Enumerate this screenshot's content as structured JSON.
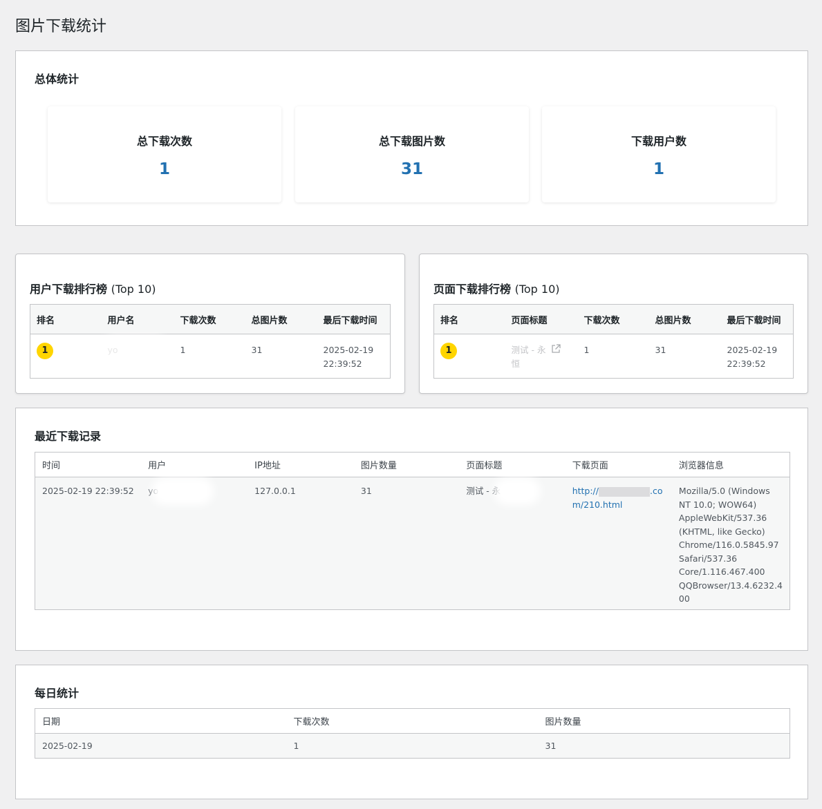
{
  "page_title": "图片下载统计",
  "overall": {
    "title": "总体统计",
    "stats": [
      {
        "label": "总下载次数",
        "value": "1"
      },
      {
        "label": "总下载图片数",
        "value": "31"
      },
      {
        "label": "下载用户数",
        "value": "1"
      }
    ]
  },
  "user_rank": {
    "title": "用户下载排行榜",
    "suffix": "(Top 10)",
    "columns": [
      "排名",
      "用户名",
      "下载次数",
      "总图片数",
      "最后下载时间"
    ],
    "rows": [
      {
        "rank": "1",
        "user": "yo",
        "downloads": "1",
        "images": "31",
        "last_date": "2025-02-19",
        "last_time": "22:39:52"
      }
    ]
  },
  "page_rank": {
    "title": "页面下载排行榜",
    "suffix": "(Top 10)",
    "columns": [
      "排名",
      "页面标题",
      "下载次数",
      "总图片数",
      "最后下载时间"
    ],
    "rows": [
      {
        "rank": "1",
        "title_line1": "测试 - 永",
        "title_line2": "恒",
        "downloads": "1",
        "images": "31",
        "last_date": "2025-02-19",
        "last_time": "22:39:52"
      }
    ]
  },
  "recent": {
    "title": "最近下载记录",
    "columns": [
      "时间",
      "用户",
      "IP地址",
      "图片数量",
      "页面标题",
      "下载页面",
      "浏览器信息"
    ],
    "rows": [
      {
        "time": "2025-02-19 22:39:52",
        "user": "yo",
        "ip": "127.0.0.1",
        "images": "31",
        "page_title": "测试 - 永",
        "url_start": "http://",
        "url_end": ".co",
        "url_line2": "m/210.html",
        "browser": [
          "Mozilla/5.0 (Windows",
          "NT 10.0; WOW64)",
          "AppleWebKit/537.36",
          "(KHTML, like Gecko)",
          "Chrome/116.0.5845.97",
          "Safari/537.36",
          "Core/1.116.467.400",
          "QQBrowser/13.4.6232.4",
          "00"
        ]
      }
    ]
  },
  "daily": {
    "title": "每日统计",
    "columns": [
      "日期",
      "下载次数",
      "图片数量"
    ],
    "rows": [
      {
        "date": "2025-02-19",
        "downloads": "1",
        "images": "31"
      }
    ]
  },
  "colors": {
    "accent": "#2271b1",
    "badge": "#ffd500",
    "background": "#f0f0f1"
  }
}
